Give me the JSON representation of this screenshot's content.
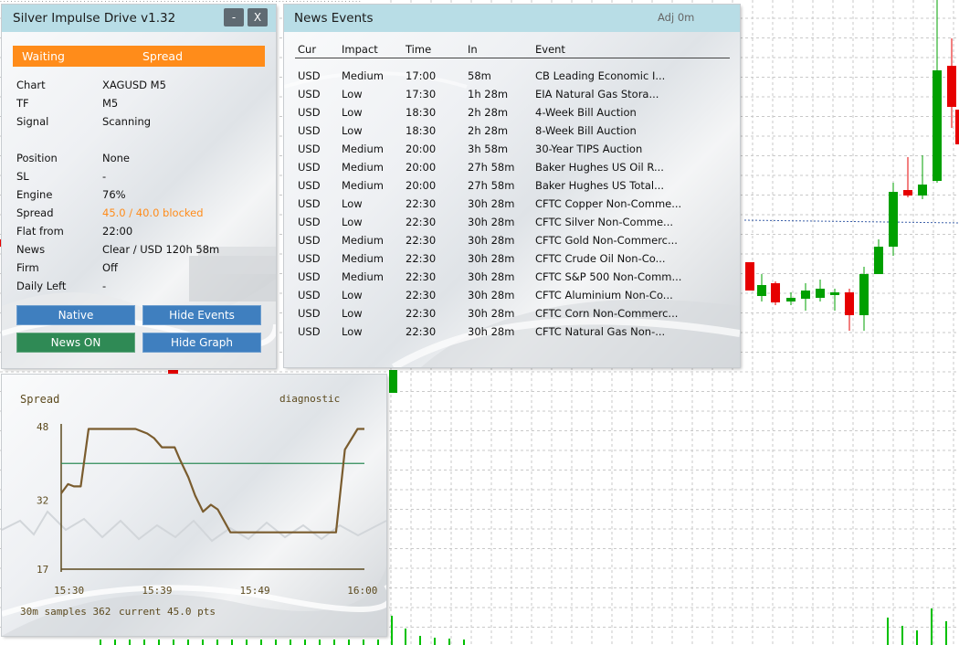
{
  "main_panel": {
    "title": "Silver Impulse Drive v1.32",
    "minimize_label": "-",
    "close_label": "X",
    "status_left": "Waiting",
    "status_right": "Spread",
    "rows": [
      {
        "label": "Chart",
        "value": "XAGUSD M5",
        "highlight": false
      },
      {
        "label": "TF",
        "value": "M5",
        "highlight": false
      },
      {
        "label": "Signal",
        "value": "Scanning",
        "highlight": false
      },
      {
        "label": "Position",
        "value": "None",
        "highlight": false
      },
      {
        "label": "SL",
        "value": "-",
        "highlight": false
      },
      {
        "label": "Engine",
        "value": "76%",
        "highlight": false
      },
      {
        "label": "Spread",
        "value": "45.0 / 40.0 blocked",
        "highlight": true
      },
      {
        "label": "Flat from",
        "value": "22:00",
        "highlight": false
      },
      {
        "label": "News",
        "value": "Clear / USD 120h 58m",
        "highlight": false
      },
      {
        "label": "Firm",
        "value": "Off",
        "highlight": false
      },
      {
        "label": "Daily Left",
        "value": "-",
        "highlight": false
      }
    ],
    "buttons": {
      "native": "Native",
      "hide_events": "Hide Events",
      "news_on": "News ON",
      "hide_graph": "Hide Graph"
    },
    "colors": {
      "status": "#ff8c1a",
      "button_blue": "#3f7fbf",
      "button_green": "#2f8a55",
      "titlebar": "#b8dde6"
    }
  },
  "news_panel": {
    "title": "News Events",
    "adj": "Adj 0m",
    "columns": [
      "Cur",
      "Impact",
      "Time",
      "In",
      "Event"
    ],
    "rows": [
      [
        "USD",
        "Medium",
        "17:00",
        "58m",
        "CB Leading Economic I..."
      ],
      [
        "USD",
        "Low",
        "17:30",
        "1h 28m",
        "EIA Natural Gas Stora..."
      ],
      [
        "USD",
        "Low",
        "18:30",
        "2h 28m",
        "4-Week Bill Auction"
      ],
      [
        "USD",
        "Low",
        "18:30",
        "2h 28m",
        "8-Week Bill Auction"
      ],
      [
        "USD",
        "Medium",
        "20:00",
        "3h 58m",
        "30-Year TIPS Auction"
      ],
      [
        "USD",
        "Medium",
        "20:00",
        "27h 58m",
        "Baker Hughes US Oil R..."
      ],
      [
        "USD",
        "Medium",
        "20:00",
        "27h 58m",
        "Baker Hughes US Total..."
      ],
      [
        "USD",
        "Low",
        "22:30",
        "30h 28m",
        "CFTC Copper Non-Comme..."
      ],
      [
        "USD",
        "Low",
        "22:30",
        "30h 28m",
        "CFTC Silver Non-Comme..."
      ],
      [
        "USD",
        "Medium",
        "22:30",
        "30h 28m",
        "CFTC Gold Non-Commerc..."
      ],
      [
        "USD",
        "Medium",
        "22:30",
        "30h 28m",
        "CFTC Crude Oil Non-Co..."
      ],
      [
        "USD",
        "Medium",
        "22:30",
        "30h 28m",
        "CFTC S&P 500 Non-Comm..."
      ],
      [
        "USD",
        "Low",
        "22:30",
        "30h 28m",
        "CFTC Aluminium Non-Co..."
      ],
      [
        "USD",
        "Low",
        "22:30",
        "30h 28m",
        "CFTC Corn Non-Commerc..."
      ],
      [
        "USD",
        "Low",
        "22:30",
        "30h 28m",
        "CFTC Natural Gas Non-..."
      ]
    ]
  },
  "graph_panel": {
    "title": "Spread",
    "mode": "diagnostic",
    "footer_samples": "30m samples 362",
    "footer_current": "current 45.0 pts",
    "colors": {
      "line": "#7a5c2e",
      "threshold": "#2e8b57",
      "text": "#5c4a1e"
    }
  },
  "chart_data": {
    "type": "line",
    "title": "Spread",
    "y_ticks": [
      "48",
      "32",
      "17"
    ],
    "x_ticks": [
      "15:30",
      "15:39",
      "15:49",
      "16:00"
    ],
    "ylim": [
      17,
      48
    ],
    "x_minutes": [
      0,
      0.7,
      1.3,
      2,
      2.8,
      3.4,
      7.6,
      8.8,
      9.5,
      10.3,
      11.6,
      12.1,
      13,
      13.7,
      14.5,
      15.3,
      16,
      17.3,
      28.1,
      29,
      30.3,
      31
    ],
    "values": [
      33.5,
      35.5,
      35,
      35,
      47.5,
      47.5,
      47.5,
      46.5,
      45.5,
      43.5,
      43.5,
      41,
      37,
      33,
      29.5,
      31,
      30,
      25,
      25,
      43,
      47.5,
      47.5
    ],
    "threshold": 40,
    "series": [
      {
        "values": [
          33.5,
          35.5,
          35,
          35,
          47.5,
          47.5,
          47.5,
          46.5,
          45.5,
          43.5,
          43.5,
          41,
          37,
          33,
          29.5,
          31,
          30,
          25,
          25,
          43,
          47.5,
          47.5
        ]
      }
    ]
  }
}
